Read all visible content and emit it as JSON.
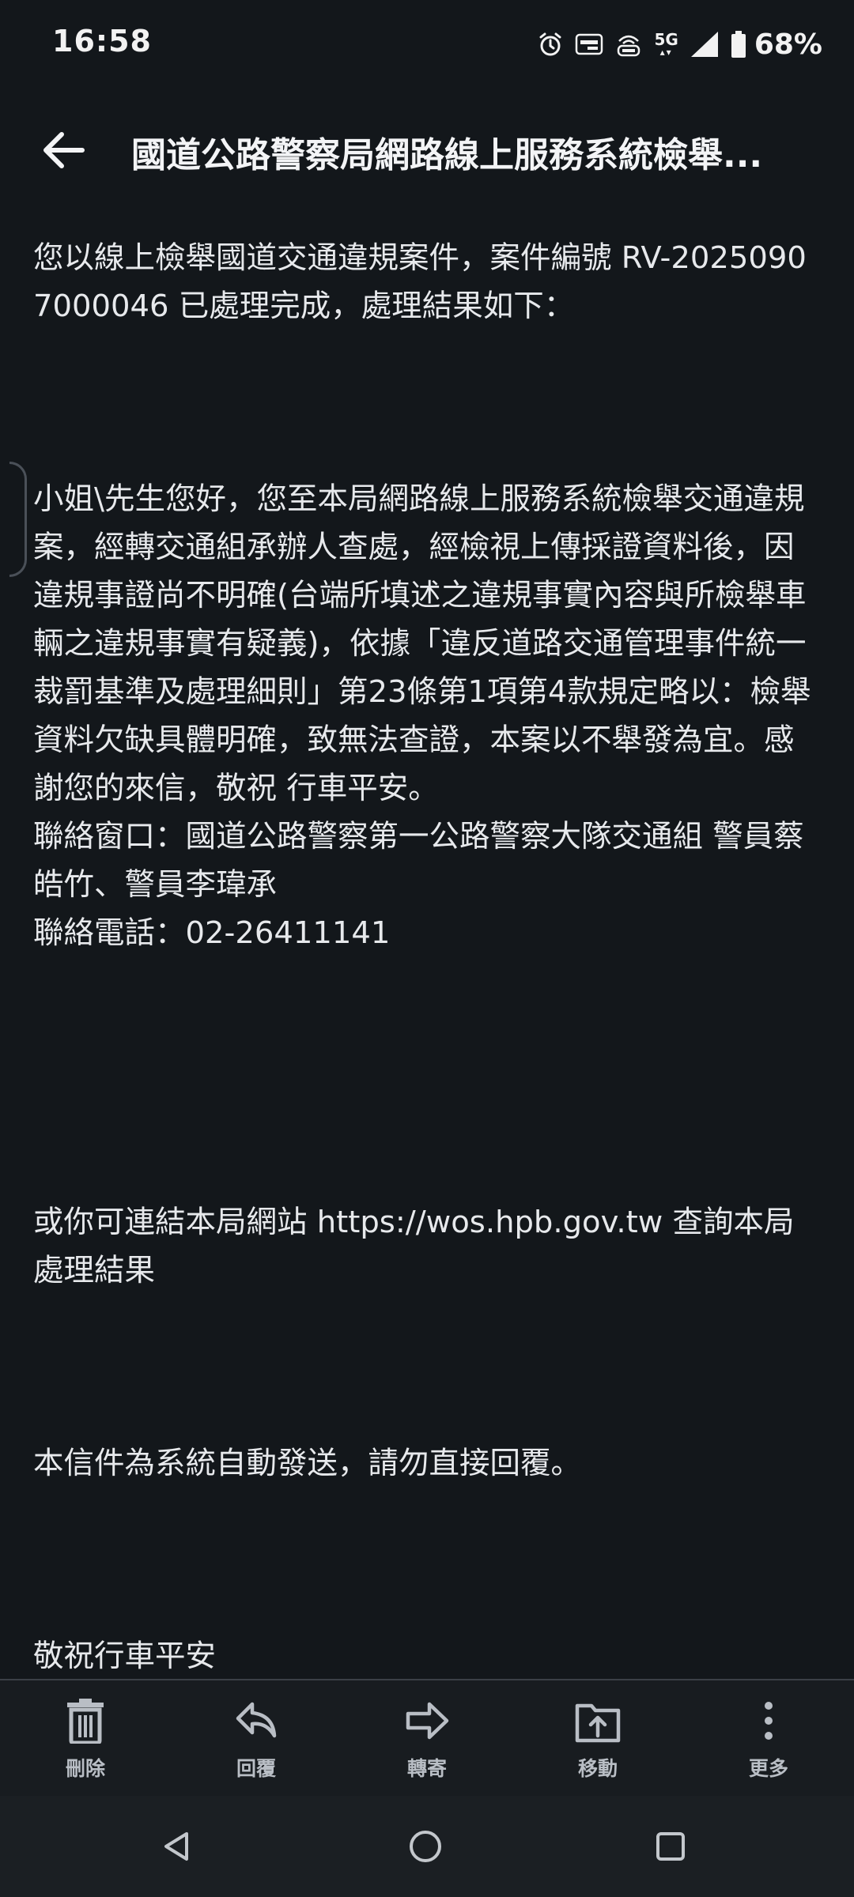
{
  "status_bar": {
    "time": "16:58",
    "network": "5G",
    "battery_percent": "68%",
    "icons": [
      "alarm-icon",
      "auto-hd-icon",
      "volte-icon",
      "5g-icon",
      "signal-icon",
      "battery-icon"
    ]
  },
  "header": {
    "title": "國道公路警察局網路線上服務系統檢舉...",
    "back_icon": "arrow-left-icon"
  },
  "email": {
    "intro": "您以線上檢舉國道交通違規案件，案件編號 RV-20250907000046 已處理完成，處理結果如下：",
    "body": "小姐\\先生您好，您至本局網路線上服務系統檢舉交通違規案，經轉交通組承辦人查處，經檢視上傳採證資料後，因違規事證尚不明確(台端所填述之違規事實內容與所檢舉車輛之違規事實有疑義)，依據「違反道路交通管理事件統一裁罰基準及處理細則」第23條第1項第4款規定略以：檢舉資料欠缺具體明確，致無法查證，本案以不舉發為宜。感謝您的來信，敬祝 行車平安。",
    "contact_window": "聯絡窗口：國道公路警察第一公路警察大隊交通組 警員蔡皓竹、警員李瑋承",
    "contact_phone": "聯絡電話：02-26411141",
    "link_text": "或你可連結本局網站 https://wos.hpb.gov.tw 查詢本局處理結果",
    "auto_notice": "本信件為系統自動發送，請勿直接回覆。",
    "closing": "敬祝行車平安"
  },
  "actions": [
    {
      "label": "刪除",
      "icon": "trash-icon"
    },
    {
      "label": "回覆",
      "icon": "reply-icon"
    },
    {
      "label": "轉寄",
      "icon": "forward-icon"
    },
    {
      "label": "移動",
      "icon": "move-icon"
    },
    {
      "label": "更多",
      "icon": "more-vertical-icon"
    }
  ],
  "nav": {
    "buttons": [
      "back-triangle-icon",
      "home-circle-icon",
      "recents-square-icon"
    ]
  },
  "colors": {
    "background": "#13171b",
    "text": "#e7e9ec",
    "action_bar": "#181c20",
    "nav_bar": "#1b1f23"
  }
}
